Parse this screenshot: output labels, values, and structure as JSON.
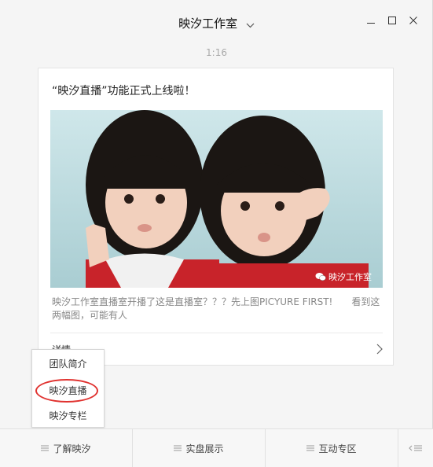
{
  "window": {
    "title": "映汐工作室",
    "controls": [
      "minimize-icon",
      "maximize-icon",
      "close-icon"
    ]
  },
  "chat": {
    "timestamp": "1:16"
  },
  "article": {
    "title": "“映汐直播”功能正式上线啦！",
    "image_watermark": "映汐工作室",
    "summary": "映汐工作室直播室开播了这是直播室？？？先上图PICYURE FIRST!　　看到这两幅图，可能有人",
    "details_label": "详情"
  },
  "popup_menu": {
    "items": [
      "团队简介",
      "映汐直播",
      "映汐专栏"
    ],
    "highlighted_index": 1,
    "highlight_color": "#e0322f"
  },
  "bottom_menu": {
    "items": [
      "了解映汐",
      "实盘展示",
      "互动专区"
    ],
    "toggle_icon": "keyboard-toggle-icon"
  }
}
